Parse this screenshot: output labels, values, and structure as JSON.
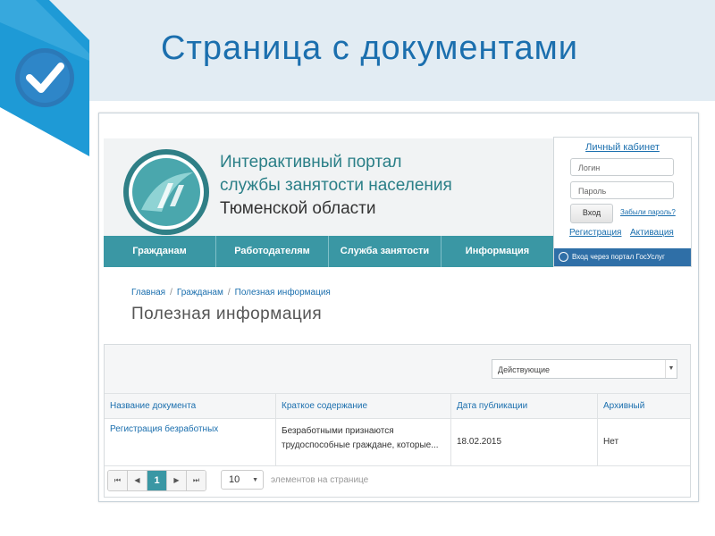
{
  "slide": {
    "title": "Страница с документами"
  },
  "portal": {
    "title_line1": "Интерактивный портал",
    "title_line2": "службы занятости населения",
    "title_line3": "Тюменской области"
  },
  "login": {
    "cabinet_label": "Личный кабинет",
    "login_placeholder": "Логин",
    "password_placeholder": "Пароль",
    "submit_label": "Вход",
    "forgot_label": "Забыли пароль?",
    "register_label": "Регистрация",
    "activate_label": "Активация",
    "gosuslugi_label": "Вход через портал ГосУслуг"
  },
  "nav": {
    "items": [
      {
        "label": "Гражданам"
      },
      {
        "label": "Работодателям"
      },
      {
        "label": "Служба занятости"
      },
      {
        "label": "Информация"
      }
    ]
  },
  "breadcrumb": [
    "Главная",
    "Гражданам",
    "Полезная информация"
  ],
  "page_heading": "Полезная информация",
  "filter": {
    "selected": "Действующие"
  },
  "table": {
    "columns": [
      "Название документа",
      "Краткое содержание",
      "Дата публикации",
      "Архивный"
    ],
    "rows": [
      {
        "name": "Регистрация безработных",
        "summary": "Безработными признаются трудоспособные граждане, которые...",
        "date": "18.02.2015",
        "archived": "Нет"
      }
    ]
  },
  "pagination": {
    "first": "⏮",
    "prev": "◀",
    "current": "1",
    "next": "▶",
    "last": "⏭",
    "per_page": "10",
    "per_page_label": "элементов на странице"
  },
  "colors": {
    "accent": "#3a97a4",
    "link": "#1b6fae",
    "badge": "#1e9ad6"
  }
}
